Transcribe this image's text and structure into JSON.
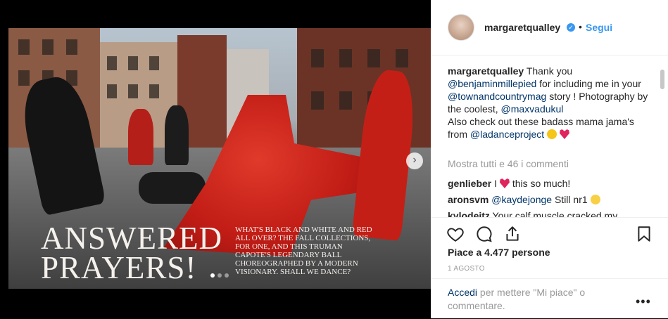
{
  "media": {
    "headline_line1": "ANSWERED",
    "headline_line2": "PRAYERS!",
    "deck": "WHAT'S BLACK AND WHITE AND RED ALL OVER? THE FALL COLLECTIONS, FOR ONE, AND THIS TRUMAN CAPOTE'S LEGENDARY BALL CHOREOGRAPHED BY A MODERN VISIONARY. SHALL WE DANCE?",
    "next_icon": "chevron-right-icon",
    "slide_count": 3,
    "active_slide": 1
  },
  "header": {
    "username": "margaretqualley",
    "separator": "•",
    "follow_label": "Segui"
  },
  "caption": {
    "username": "margaretqualley",
    "t1": "Thank you",
    "m1": "@benjaminmillepied",
    "t2": "for including me in your",
    "m2": "@townandcountrymag",
    "t3": "story ! Photography by the coolest,",
    "m3": "@maxvadukul",
    "t4": "Also check out these badass mama jama's from",
    "m4": "@ladanceproject"
  },
  "view_all": "Mostra tutti e 46 i commenti",
  "comments": [
    {
      "user": "genlieber",
      "text_before": "I",
      "text_after": "this so much!"
    },
    {
      "user": "aronsvm",
      "mention": "@kaydejonge",
      "text": "Still nr1"
    },
    {
      "user": "kylodeitz",
      "text": "Your calf muscle cracked my"
    }
  ],
  "actions": {
    "like_icon": "heart-icon",
    "comment_icon": "comment-icon",
    "share_icon": "share-icon",
    "save_icon": "bookmark-icon"
  },
  "likes_text": "Piace a 4.477 persone",
  "date": "1 AGOSTO",
  "login": {
    "link": "Accedi",
    "text": "per mettere \"Mi piace\" o commentare.",
    "more": "•••"
  },
  "colors": {
    "link": "#3897f0",
    "mention": "#003569",
    "muted": "#999999",
    "dress": "#c21d16"
  }
}
